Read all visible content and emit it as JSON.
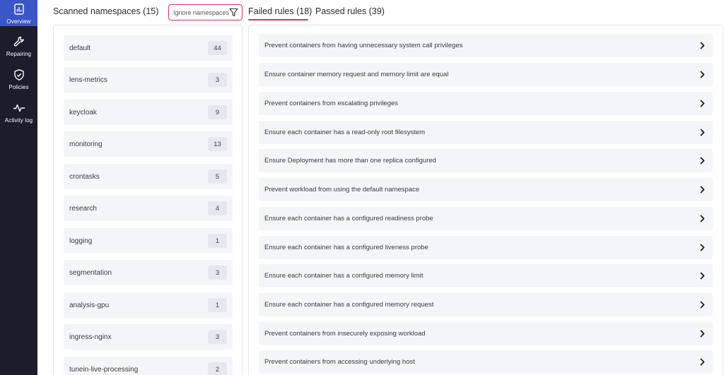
{
  "sidebar": {
    "items": [
      {
        "label": "Overview",
        "icon": "chart-bar-icon",
        "active": true
      },
      {
        "label": "Repairing",
        "icon": "wrench-icon",
        "active": false
      },
      {
        "label": "Policies",
        "icon": "shield-check-icon",
        "active": false
      },
      {
        "label": "Activity log",
        "icon": "pulse-icon",
        "active": false
      }
    ]
  },
  "namespaces": {
    "title": "Scanned namespaces (15)",
    "ignore_button_label": "Ignore namespaces",
    "items": [
      {
        "name": "default",
        "count": "44"
      },
      {
        "name": "lens-metrics",
        "count": "3"
      },
      {
        "name": "keycloak",
        "count": "9"
      },
      {
        "name": "monitoring",
        "count": "13"
      },
      {
        "name": "crontasks",
        "count": "5"
      },
      {
        "name": "research",
        "count": "4"
      },
      {
        "name": "logging",
        "count": "1"
      },
      {
        "name": "segmentation",
        "count": "3"
      },
      {
        "name": "analysis-gpu",
        "count": "1"
      },
      {
        "name": "ingress-nginx",
        "count": "3"
      },
      {
        "name": "tunein-live-processing",
        "count": "2"
      }
    ]
  },
  "tabs": {
    "failed": "Failed rules (18)",
    "passed": "Passed rules (39)",
    "active_color": "#d6336c"
  },
  "rules": {
    "items": [
      "Prevent containers from having unnecessary system call privileges",
      "Ensure container memory request and memory limit are equal",
      "Prevent containers from escalating privileges",
      "Ensure each container has a read-only root filesystem",
      "Ensure Deployment has more than one replica configured",
      "Prevent workload from using the default namespace",
      "Ensure each container has a configured readiness probe",
      "Ensure each container has a configured liveness probe",
      "Ensure each container has a configured memory limit",
      "Ensure each container has a configured memory request",
      "Prevent containers from insecurely exposing workload",
      "Prevent containers from accessing underlying host"
    ]
  }
}
